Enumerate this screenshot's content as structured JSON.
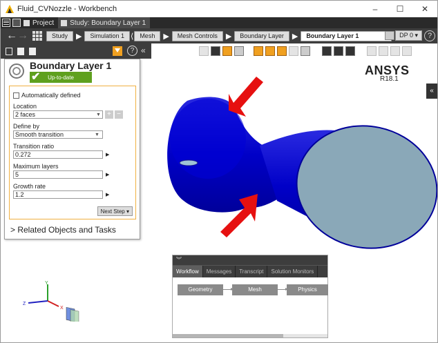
{
  "window": {
    "title": "Fluid_CVNozzle - Workbench",
    "controls": {
      "minimize": "–",
      "maximize": "☐",
      "close": "✕"
    }
  },
  "tabs": [
    {
      "label": "Project"
    },
    {
      "label": "Study: Boundary Layer 1"
    }
  ],
  "breadcrumb": {
    "back": "←",
    "forward": "→",
    "items": [
      "Study",
      "Simulation 1",
      "Mesh",
      "Mesh Controls",
      "Boundary Layer",
      "Boundary Layer 1"
    ],
    "dp": "DP 0 ▾",
    "help": "?"
  },
  "panel": {
    "title": "Boundary Layer 1",
    "status": "Up-to-date",
    "auto_defined_label": "Automatically defined",
    "auto_defined_checked": false,
    "location_label": "Location",
    "location_value": "2 faces",
    "define_by_label": "Define by",
    "define_by_value": "Smooth transition",
    "transition_ratio_label": "Transition ratio",
    "transition_ratio_value": "0.272",
    "max_layers_label": "Maximum layers",
    "max_layers_value": "5",
    "growth_rate_label": "Growth rate",
    "growth_rate_value": "1.2",
    "next_step": "Next Step ▾",
    "related": "Related Objects and Tasks"
  },
  "view": {
    "brand": "ANSYS",
    "version": "R18.1",
    "model_color": "#0000cc",
    "face_color": "#8aa8b8",
    "arrow_color": "#e61010"
  },
  "triad": {
    "x": "X",
    "y": "Y",
    "z": "Z"
  },
  "workflow": {
    "tabs": [
      "Workflow",
      "Messages",
      "Transcript",
      "Solution Monitors"
    ],
    "nodes": [
      "Geometry",
      "Mesh",
      "Physics"
    ]
  }
}
